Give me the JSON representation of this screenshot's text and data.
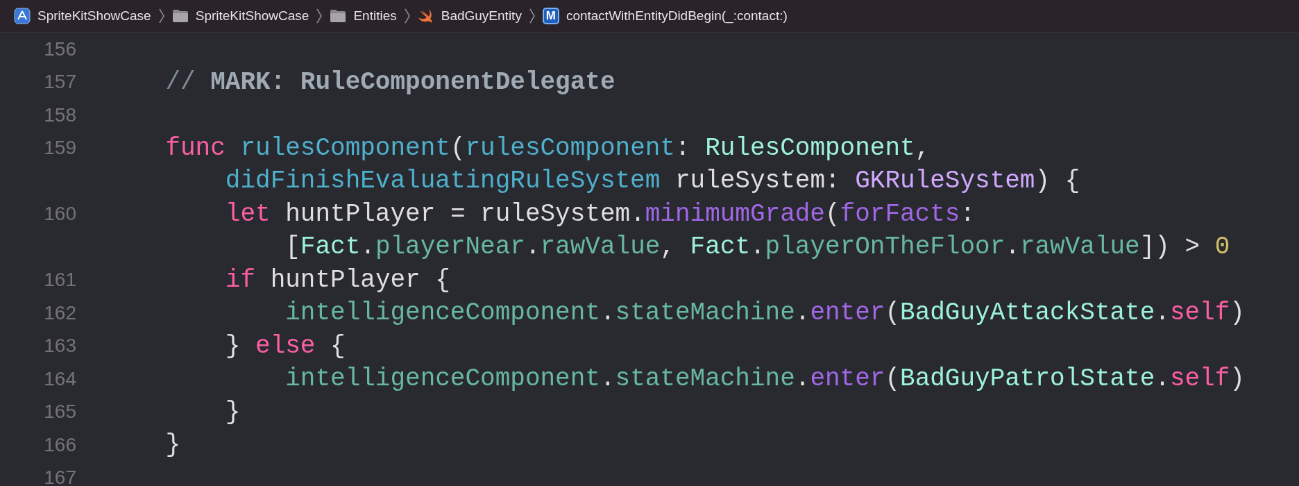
{
  "breadcrumbs": [
    {
      "kind": "app",
      "label": "SpriteKitShowCase"
    },
    {
      "kind": "folder",
      "label": "SpriteKitShowCase"
    },
    {
      "kind": "folder",
      "label": "Entities"
    },
    {
      "kind": "swift",
      "label": "BadGuyEntity"
    },
    {
      "kind": "method",
      "badge": "M",
      "label": "contactWithEntityDidBegin(_:contact:)"
    }
  ],
  "lines": [
    {
      "number": "156",
      "kind": "blank"
    },
    {
      "number": "157",
      "kind": "indent1",
      "tokens": [
        {
          "kind": "comment",
          "text": "// "
        },
        {
          "kind": "mark",
          "text": "MARK: RuleComponentDelegate"
        }
      ]
    },
    {
      "number": "158",
      "kind": "blank"
    },
    {
      "number": "159",
      "kind": "indent1",
      "tokens": [
        {
          "kind": "keyword",
          "text": "func "
        },
        {
          "kind": "decl",
          "text": "rulesComponent"
        },
        {
          "kind": "plain",
          "text": "("
        },
        {
          "kind": "decl",
          "text": "rulesComponent"
        },
        {
          "kind": "plain",
          "text": ": "
        },
        {
          "kind": "type",
          "text": "RulesComponent"
        },
        {
          "kind": "plain",
          "text": ","
        }
      ]
    },
    {
      "kind": "indent2",
      "tokens": [
        {
          "kind": "decl",
          "text": "didFinishEvaluatingRuleSystem"
        },
        {
          "kind": "plain",
          "text": " ruleSystem: "
        },
        {
          "kind": "systype",
          "text": "GKRuleSystem"
        },
        {
          "kind": "plain",
          "text": ") {"
        }
      ]
    },
    {
      "number": "160",
      "kind": "indent2",
      "tokens": [
        {
          "kind": "keyword",
          "text": "let"
        },
        {
          "kind": "plain",
          "text": " huntPlayer = ruleSystem."
        },
        {
          "kind": "sysmethod",
          "text": "minimumGrade"
        },
        {
          "kind": "plain",
          "text": "("
        },
        {
          "kind": "sysmethod",
          "text": "forFacts"
        },
        {
          "kind": "plain",
          "text": ":"
        }
      ]
    },
    {
      "kind": "indent3",
      "tokens": [
        {
          "kind": "plain",
          "text": "["
        },
        {
          "kind": "type",
          "text": "Fact"
        },
        {
          "kind": "plain",
          "text": "."
        },
        {
          "kind": "prop",
          "text": "playerNear"
        },
        {
          "kind": "plain",
          "text": "."
        },
        {
          "kind": "prop",
          "text": "rawValue"
        },
        {
          "kind": "plain",
          "text": ", "
        },
        {
          "kind": "type",
          "text": "Fact"
        },
        {
          "kind": "plain",
          "text": "."
        },
        {
          "kind": "prop",
          "text": "playerOnTheFloor"
        },
        {
          "kind": "plain",
          "text": "."
        },
        {
          "kind": "prop",
          "text": "rawValue"
        },
        {
          "kind": "plain",
          "text": "]) > "
        },
        {
          "kind": "number",
          "text": "0"
        }
      ]
    },
    {
      "number": "161",
      "kind": "indent2",
      "tokens": [
        {
          "kind": "keyword",
          "text": "if"
        },
        {
          "kind": "plain",
          "text": " huntPlayer {"
        }
      ]
    },
    {
      "number": "162",
      "kind": "indent3",
      "tokens": [
        {
          "kind": "prop",
          "text": "intelligenceComponent"
        },
        {
          "kind": "plain",
          "text": "."
        },
        {
          "kind": "prop",
          "text": "stateMachine"
        },
        {
          "kind": "plain",
          "text": "."
        },
        {
          "kind": "sysmethod",
          "text": "enter"
        },
        {
          "kind": "plain",
          "text": "("
        },
        {
          "kind": "type",
          "text": "BadGuyAttackState"
        },
        {
          "kind": "plain",
          "text": "."
        },
        {
          "kind": "keyword",
          "text": "self"
        },
        {
          "kind": "plain",
          "text": ")"
        }
      ]
    },
    {
      "number": "163",
      "kind": "indent2",
      "tokens": [
        {
          "kind": "plain",
          "text": "} "
        },
        {
          "kind": "keyword",
          "text": "else"
        },
        {
          "kind": "plain",
          "text": " {"
        }
      ]
    },
    {
      "number": "164",
      "kind": "indent3",
      "tokens": [
        {
          "kind": "prop",
          "text": "intelligenceComponent"
        },
        {
          "kind": "plain",
          "text": "."
        },
        {
          "kind": "prop",
          "text": "stateMachine"
        },
        {
          "kind": "plain",
          "text": "."
        },
        {
          "kind": "sysmethod",
          "text": "enter"
        },
        {
          "kind": "plain",
          "text": "("
        },
        {
          "kind": "type",
          "text": "BadGuyPatrolState"
        },
        {
          "kind": "plain",
          "text": "."
        },
        {
          "kind": "keyword",
          "text": "self"
        },
        {
          "kind": "plain",
          "text": ")"
        }
      ]
    },
    {
      "number": "165",
      "kind": "indent2",
      "tokens": [
        {
          "kind": "plain",
          "text": "}"
        }
      ]
    },
    {
      "number": "166",
      "kind": "indent1",
      "tokens": [
        {
          "kind": "plain",
          "text": "}"
        }
      ]
    },
    {
      "number": "167",
      "kind": "blank"
    }
  ]
}
